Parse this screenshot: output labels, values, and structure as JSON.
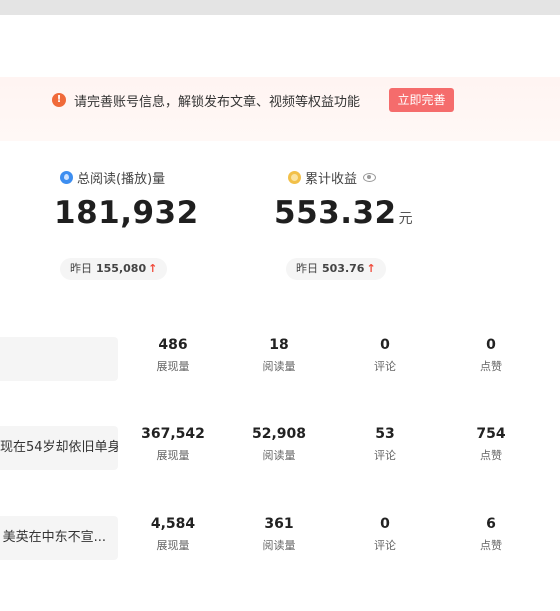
{
  "notice": {
    "text": "请完善账号信息，解锁发布文章、视频等权益功能",
    "button": "立即完善"
  },
  "stats": {
    "reads": {
      "label": "总阅读(播放)量",
      "value": "181,932",
      "yesterday_label": "昨日",
      "yesterday_value": "155,080",
      "icon": "read-drop-icon"
    },
    "earnings": {
      "label": "累计收益",
      "value": "553.32",
      "unit": "元",
      "yesterday_label": "昨日",
      "yesterday_value": "503.76",
      "icon": "coin-icon"
    }
  },
  "articles": [
    {
      "title": "",
      "impressions": "486",
      "impressions_label": "展现量",
      "reads": "18",
      "reads_label": "阅读量",
      "comments": "0",
      "comments_label": "评论",
      "likes": "0",
      "likes_label": "点赞"
    },
    {
      "title": "现在54岁却依旧单身",
      "impressions": "367,542",
      "impressions_label": "展现量",
      "reads": "52,908",
      "reads_label": "阅读量",
      "comments": "53",
      "comments_label": "评论",
      "likes": "754",
      "likes_label": "点赞"
    },
    {
      "title": "美英在中东不宣...",
      "impressions": "4,584",
      "impressions_label": "展现量",
      "reads": "361",
      "reads_label": "阅读量",
      "comments": "0",
      "comments_label": "评论",
      "likes": "6",
      "likes_label": "点赞"
    }
  ],
  "colors": {
    "accent": "#f56c6c",
    "warning": "#f06a3a",
    "trend_up": "#f04b3c"
  }
}
